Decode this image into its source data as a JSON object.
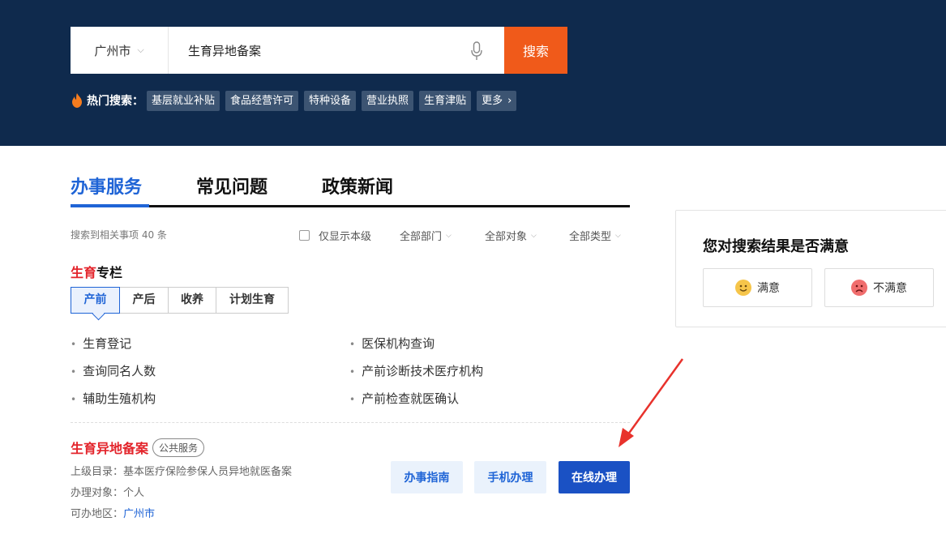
{
  "search": {
    "city": "广州市",
    "query": "生育异地备案",
    "button": "搜索"
  },
  "hot": {
    "label": "热门搜索：",
    "tags": [
      "基层就业补贴",
      "食品经营许可",
      "特种设备",
      "营业执照",
      "生育津贴"
    ],
    "more": "更多",
    "more_icon": "chevron-right"
  },
  "tabs": [
    "办事服务",
    "常见问题",
    "政策新闻"
  ],
  "results": {
    "count_text": "搜索到相关事项 40 条",
    "filter_local": "仅显示本级",
    "filter_dept": "全部部门",
    "filter_target": "全部对象",
    "filter_type": "全部类型"
  },
  "column": {
    "title_red": "生育",
    "title_black": "专栏",
    "subtabs": [
      "产前",
      "产后",
      "收养",
      "计划生育"
    ],
    "links_left": [
      "生育登记",
      "查询同名人数",
      "辅助生殖机构"
    ],
    "links_right": [
      "医保机构查询",
      "产前诊断技术医疗机构",
      "产前检查就医确认"
    ]
  },
  "item": {
    "name": "生育异地备案",
    "badge": "公共服务",
    "parent_label": "上级目录：",
    "parent_value": "基本医疗保险参保人员异地就医备案",
    "target_label": "办理对象：",
    "target_value": "个人",
    "area_label": "可办地区：",
    "area_value": "广州市",
    "btn_guide": "办事指南",
    "btn_mobile": "手机办理",
    "btn_online": "在线办理"
  },
  "feedback": {
    "title": "您对搜索结果是否满意",
    "satisfied": "满意",
    "unsatisfied": "不满意"
  },
  "colors": {
    "header_bg": "#0f2a4d",
    "accent_blue": "#1f64d6",
    "search_orange": "#f05a1a",
    "highlight_red": "#e3242b"
  }
}
